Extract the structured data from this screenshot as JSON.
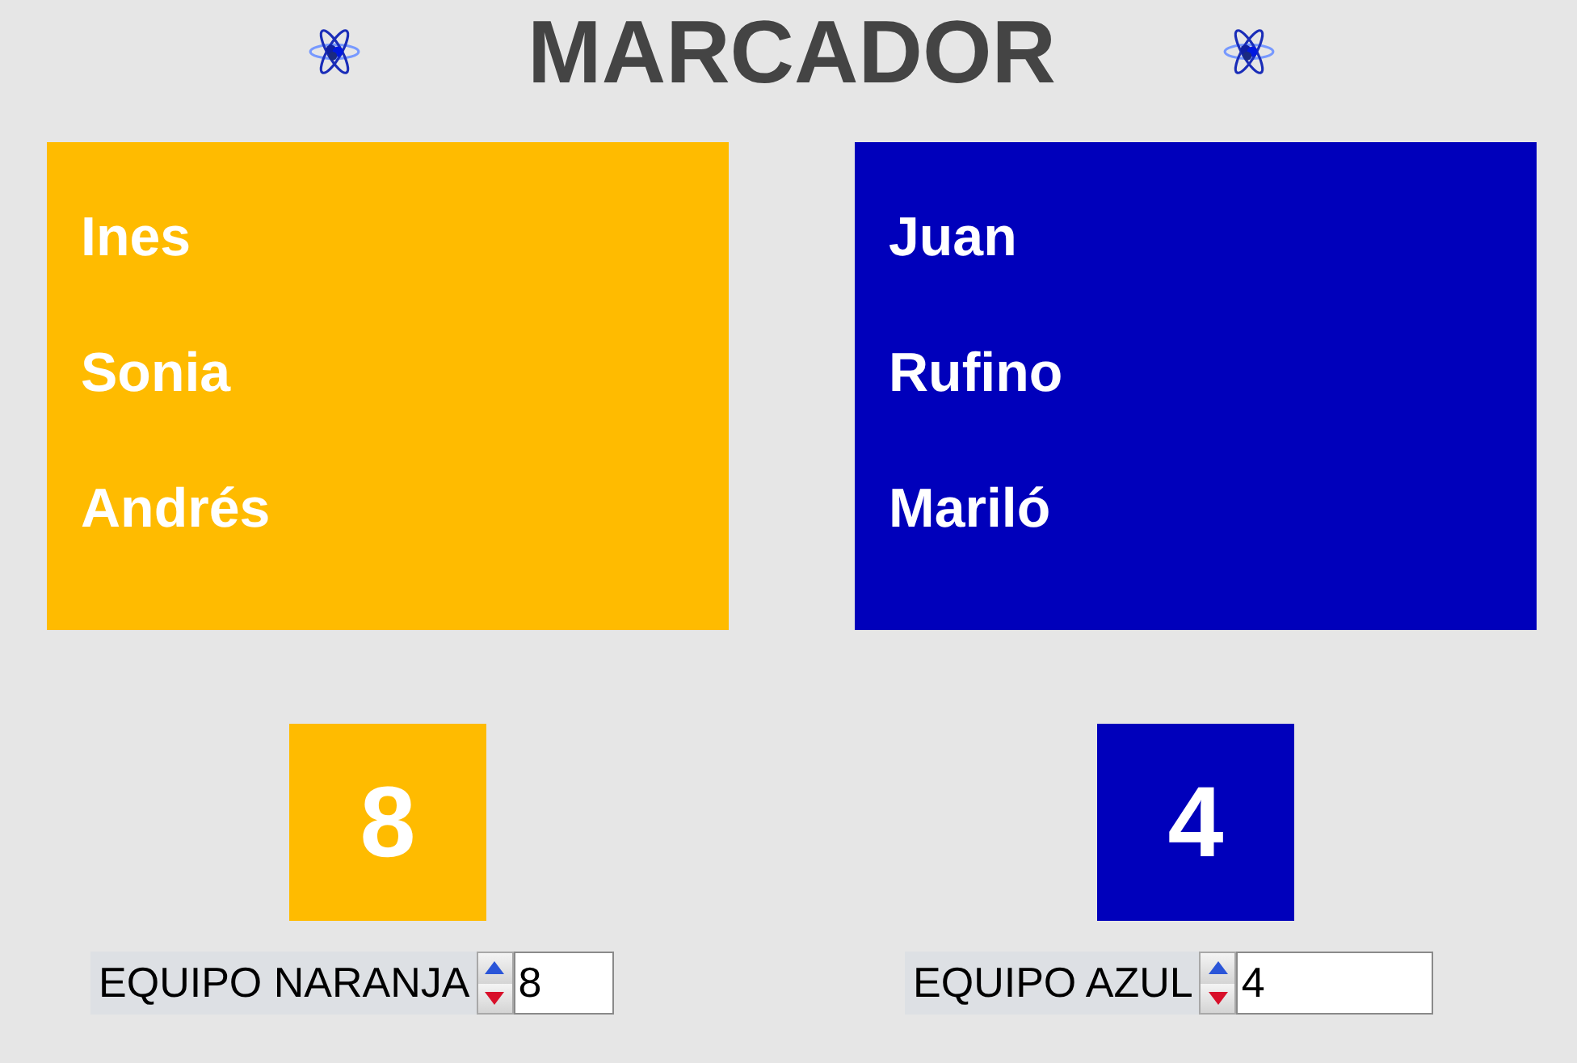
{
  "title": "MARCADOR",
  "teams": [
    {
      "color": "#ffbb00",
      "players": [
        "Ines",
        "Sonia",
        "Andrés"
      ],
      "score": "8",
      "control": {
        "label": "EQUIPO NARANJA",
        "value": "8"
      }
    },
    {
      "color": "#0000bb",
      "players": [
        "Juan",
        "Rufino",
        "Mariló"
      ],
      "score": "4",
      "control": {
        "label": "EQUIPO AZUL",
        "value": "4"
      }
    }
  ]
}
